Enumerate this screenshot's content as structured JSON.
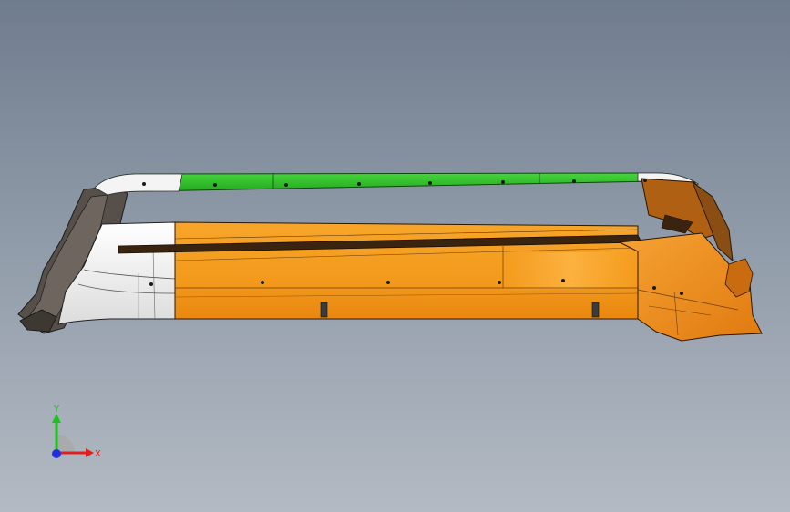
{
  "viewport": {
    "background_top": "#6f7c8d",
    "background_bottom": "#b3bac3"
  },
  "model": {
    "colors": {
      "green_trim": "#2fc22a",
      "orange_body": "#f39a1c",
      "orange_shadow": "#d97a0a",
      "white_section": "#f2f2f2",
      "dark_bracket": "#5a5048"
    }
  },
  "triad": {
    "x_label": "X",
    "y_label": "Y",
    "x_color": "#e02020",
    "y_color": "#20c020",
    "z_color": "#2030e0"
  }
}
